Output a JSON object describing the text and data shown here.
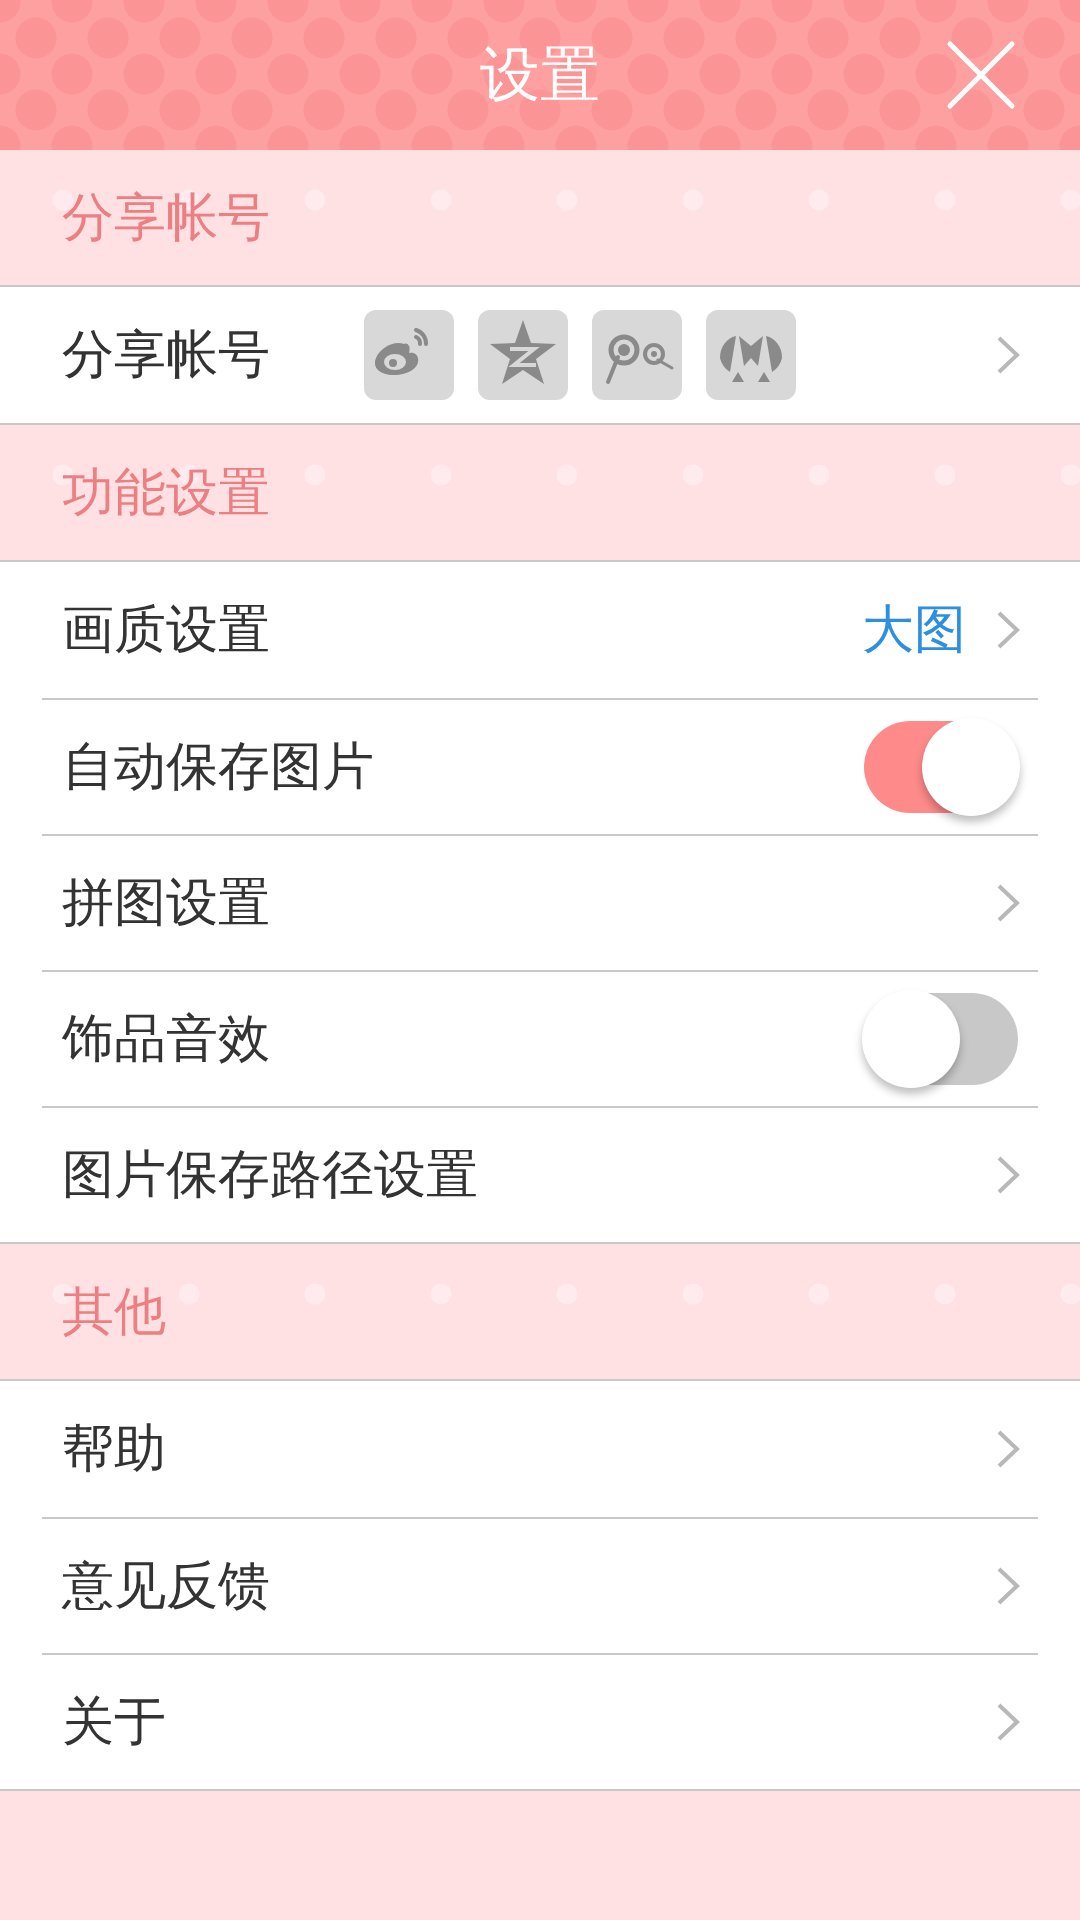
{
  "header": {
    "title": "设置"
  },
  "sections": [
    {
      "title": "分享帐号",
      "items": [
        {
          "kind": "share",
          "label": "分享帐号",
          "accounts": [
            {
              "kind": "weibo"
            },
            {
              "kind": "qzone"
            },
            {
              "kind": "tencent"
            },
            {
              "kind": "renren"
            }
          ]
        }
      ]
    },
    {
      "title": "功能设置",
      "items": [
        {
          "kind": "link",
          "label": "画质设置",
          "value": "大图"
        },
        {
          "kind": "toggle",
          "label": "自动保存图片",
          "on": true
        },
        {
          "kind": "link",
          "label": "拼图设置"
        },
        {
          "kind": "toggle",
          "label": "饰品音效",
          "on": false
        },
        {
          "kind": "link",
          "label": "图片保存路径设置"
        }
      ]
    },
    {
      "title": "其他",
      "items": [
        {
          "kind": "link",
          "label": "帮助"
        },
        {
          "kind": "link",
          "label": "意见反馈"
        },
        {
          "kind": "link",
          "label": "关于"
        }
      ]
    }
  ]
}
